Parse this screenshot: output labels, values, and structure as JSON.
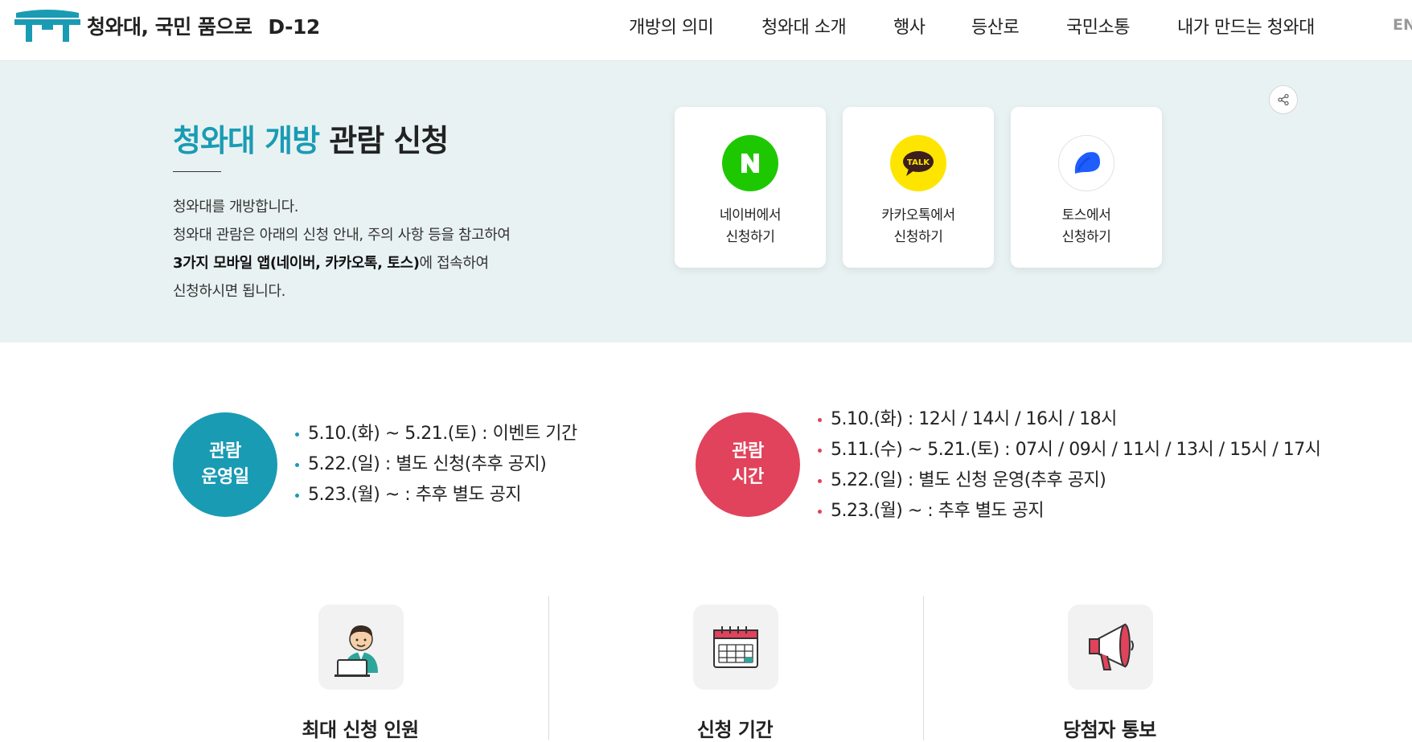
{
  "header": {
    "brand": "청와대, 국민 품으로",
    "dday": "D-12",
    "nav": [
      "개방의 의미",
      "청와대 소개",
      "행사",
      "등산로",
      "국민소통",
      "내가 만드는 청와대"
    ],
    "lang": "EN"
  },
  "hero": {
    "title_accent": "청와대 개방",
    "title_rest": "관람 신청",
    "desc_line1": "청와대를 개방합니다.",
    "desc_line2": "청와대 관람은 아래의 신청 안내, 주의 사항 등을 참고하여",
    "desc_line3_bold": "3가지 모바일 앱(네이버, 카카오톡, 토스)",
    "desc_line3_rest": "에 접속하여",
    "desc_line4": "신청하시면 됩니다.",
    "cards": [
      {
        "line1": "네이버에서",
        "line2": "신청하기",
        "icon": "naver-icon"
      },
      {
        "line1": "카카오톡에서",
        "line2": "신청하기",
        "icon": "kakaotalk-icon"
      },
      {
        "line1": "토스에서",
        "line2": "신청하기",
        "icon": "toss-icon"
      }
    ],
    "kakao_badge": "TALK"
  },
  "schedule": {
    "days_label_1": "관람",
    "days_label_2": "운영일",
    "days": [
      "5.10.(화) ~ 5.21.(토) : 이벤트 기간",
      "5.22.(일) : 별도 신청(추후 공지)",
      "5.23.(월) ~ : 추후 별도 공지"
    ],
    "time_label_1": "관람",
    "time_label_2": "시간",
    "times": [
      "5.10.(화) : 12시 / 14시 / 16시 / 18시",
      "5.11.(수) ~ 5.21.(토) : 07시 / 09시 / 11시 / 13시 / 15시 / 17시",
      "5.22.(일) : 별도 신청 운영(추후 공지)",
      "5.23.(월) ~ : 추후 별도 공지"
    ]
  },
  "info": [
    {
      "title": "최대 신청 인원",
      "icon": "person-laptop-icon"
    },
    {
      "title": "신청 기간",
      "icon": "calendar-icon"
    },
    {
      "title": "당첨자 통보",
      "icon": "megaphone-icon"
    }
  ],
  "colors": {
    "teal": "#1a9bb4",
    "red": "#e0435b",
    "hero_bg": "#e9f2f2",
    "naver": "#1ec800",
    "kakao": "#fee500",
    "toss": "#1e5eff"
  }
}
